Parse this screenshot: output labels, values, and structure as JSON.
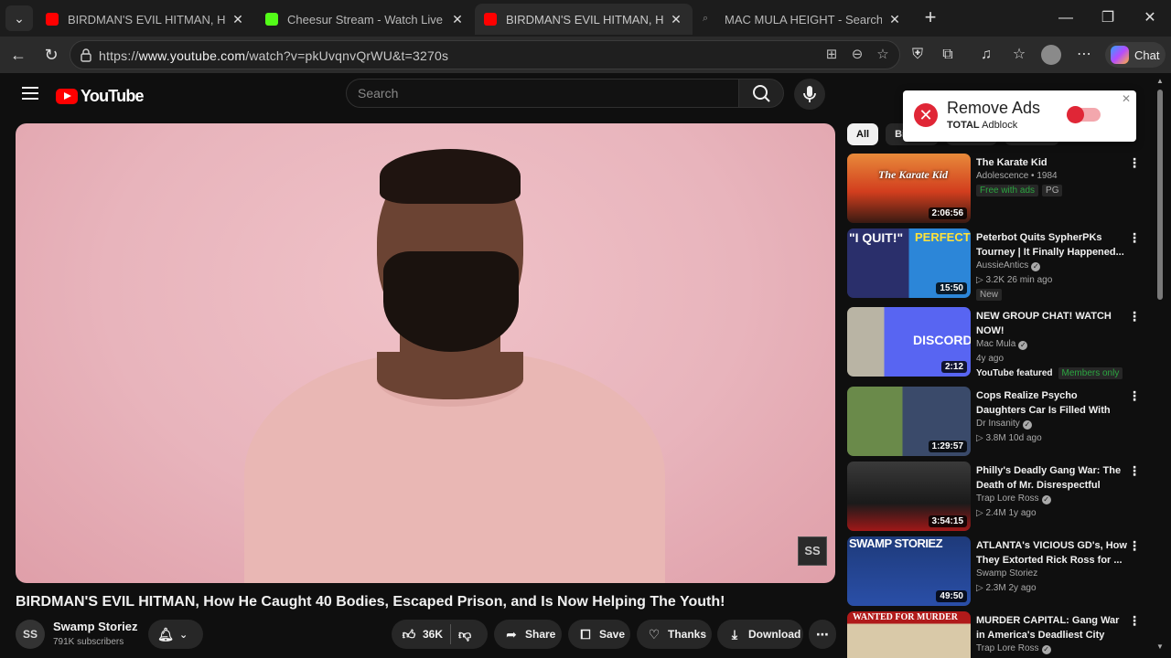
{
  "browser": {
    "tabs": [
      {
        "title": "BIRDMAN'S EVIL HITMAN, How Ha",
        "favicon": "youtube-icon"
      },
      {
        "title": "Cheesur Stream - Watch Live on K",
        "favicon": "kick-icon"
      },
      {
        "title": "BIRDMAN'S EVIL HITMAN, How He",
        "favicon": "youtube-icon"
      },
      {
        "title": "MAC MULA HEIGHT - Search",
        "favicon": "search-icon"
      }
    ],
    "url_prefix": "https://",
    "url_domain": "www.youtube.com",
    "url_path": "/watch?v=pkUvqnvQrWU&t=3270s",
    "chat_label": "Chat"
  },
  "youtube": {
    "logo_text": "YouTube",
    "search_placeholder": "Search"
  },
  "video": {
    "title": "BIRDMAN'S EVIL HITMAN, How He Caught 40 Bodies, Escaped Prison, and Is Now Helping The Youth!",
    "channel": "Swamp Storiez",
    "subscribers": "791K subscribers",
    "likes": "36K",
    "badge": "SS",
    "actions": {
      "share": "Share",
      "save": "Save",
      "thanks": "Thanks",
      "download": "Download"
    }
  },
  "filters": [
    "All",
    "Bir",
    "",
    ""
  ],
  "adblock": {
    "title": "Remove Ads",
    "brand": "TOTAL",
    "product": "Adblock"
  },
  "recommendations": [
    {
      "title": "The Karate Kid",
      "line1": "Adolescence • 1984",
      "line2": "",
      "badges": [
        "Free with ads",
        "PG"
      ],
      "duration": "2:06:56"
    },
    {
      "title": "Peterbot Quits SypherPKs Tourney | It Finally Happened...",
      "line1": "AussieAntics",
      "verified": true,
      "line2": "▷ 3.2K  26 min ago",
      "badges": [
        "New"
      ],
      "duration": "15:50"
    },
    {
      "title": "NEW GROUP CHAT!  WATCH NOW!",
      "line1": "Mac Mula",
      "verified": true,
      "line2": "4y ago",
      "featured": "YouTube featured",
      "members": "Members only",
      "duration": "2:12"
    },
    {
      "title": "Cops Realize Psycho Daughters Car Is Filled With Bodies",
      "line1": "Dr Insanity",
      "verified": true,
      "line2": "▷ 3.8M  10d ago",
      "duration": "1:29:57"
    },
    {
      "title": "Philly's Deadly Gang War: The Death of Mr. Disrespectful",
      "line1": "Trap Lore Ross",
      "verified": true,
      "line2": "▷ 2.4M  1y ago",
      "duration": "3:54:15"
    },
    {
      "title": "ATLANTA's VICIOUS GD's, How They Extorted Rick Ross for ...",
      "line1": "Swamp Storiez",
      "line2": "▷ 2.3M  2y ago",
      "duration": "49:50"
    },
    {
      "title": "MURDER CAPITAL: Gang War in America's Deadliest City",
      "line1": "Trap Lore Ross",
      "verified": true,
      "line2": "",
      "duration": ""
    }
  ],
  "thumb_texts": {
    "karate": "The Karate Kid",
    "iquit": "\"I QUIT!\"",
    "perfect": "PERFECT",
    "discord": "DISCORD",
    "swamp": "SWAMP STORIEZ",
    "wanted": "WANTED FOR MURDER"
  },
  "colors": {
    "youtube_red": "#ff0000",
    "adblock_red": "#e02636",
    "members_green": "#2ba640"
  }
}
